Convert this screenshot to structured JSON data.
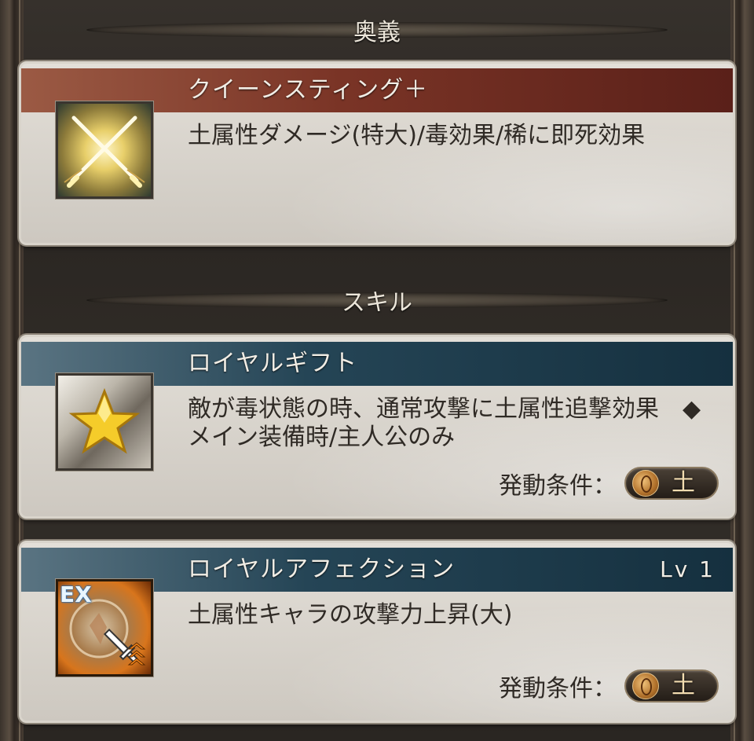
{
  "sections": {
    "ougi_title": "奥義",
    "skill_title": "スキル"
  },
  "ougi": {
    "name": "クイーンスティング＋",
    "description": "土属性ダメージ(特大)/毒効果/稀に即死効果",
    "icon": "crossed-swords-icon"
  },
  "skills": [
    {
      "name": "ロイヤルギフト",
      "description": "敵が毒状態の時、通常攻撃に土属性追撃効果　◆メイン装備時/主人公のみ",
      "icon": "star-icon",
      "condition_label": "発動条件：",
      "condition_element": "土"
    },
    {
      "name": "ロイヤルアフェクション",
      "level": "Lv 1",
      "description": "土属性キャラの攻撃力上昇(大)",
      "icon": "ex-sword-up-icon",
      "icon_badge": "EX",
      "condition_label": "発動条件：",
      "condition_element": "土"
    }
  ],
  "colors": {
    "ougi_band": "#7a3426",
    "skill_band": "#254556",
    "card_body": "#d8d3cb"
  }
}
